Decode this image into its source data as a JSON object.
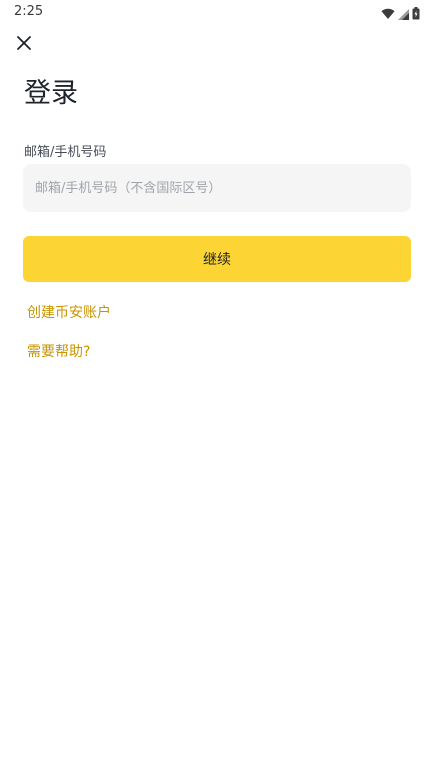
{
  "status_bar": {
    "time": "2:25",
    "icons": [
      "wifi-icon",
      "cell-signal-icon",
      "battery-charging-icon"
    ]
  },
  "header": {
    "close_icon": "close-icon",
    "title": "登录"
  },
  "form": {
    "field_label": "邮箱/手机号码",
    "input_placeholder": "邮箱/手机号码（不含国际区号）",
    "input_value": "",
    "continue_label": "继续"
  },
  "links": {
    "create_account": "创建币安账户",
    "need_help": "需要帮助?"
  },
  "colors": {
    "accent": "#FCD535",
    "link": "#C99400",
    "input_bg": "#F5F5F5",
    "title": "#1E2329"
  }
}
